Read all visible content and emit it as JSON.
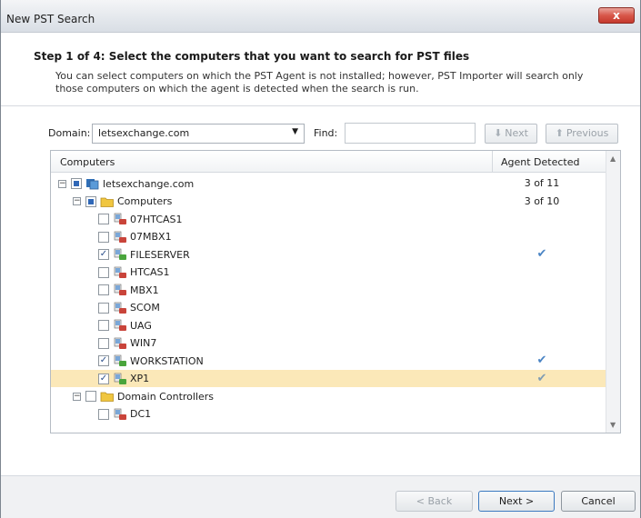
{
  "window": {
    "title": "New PST Search",
    "close_label": "x"
  },
  "header": {
    "step": "Step 1 of 4: Select the computers that you want to search for PST files",
    "description": "You can select computers on which the PST Agent is not installed; however, PST Importer will search only those computers on which the agent is detected when the search is run."
  },
  "toolbar": {
    "domain_label": "Domain:",
    "domain_value": "letsexchange.com",
    "find_label": "Find:",
    "find_value": "",
    "find_next_label": "Next",
    "find_previous_label": "Previous"
  },
  "grid": {
    "columns": [
      "Computers",
      "Agent Detected"
    ],
    "rows": [
      {
        "label": "letsexchange.com",
        "level": 0,
        "type": "domain",
        "checkbox": "partial",
        "expander": "−",
        "agent": "3 of 11",
        "agent_check": false,
        "selected": false
      },
      {
        "label": "Computers",
        "level": 1,
        "type": "folder",
        "checkbox": "partial",
        "expander": "−",
        "agent": "3 of 10",
        "agent_check": false,
        "selected": false
      },
      {
        "label": "07HTCAS1",
        "level": 2,
        "type": "computer-red",
        "checkbox": "unchecked",
        "agent": "",
        "agent_check": false,
        "selected": false
      },
      {
        "label": "07MBX1",
        "level": 2,
        "type": "computer-red",
        "checkbox": "unchecked",
        "agent": "",
        "agent_check": false,
        "selected": false
      },
      {
        "label": "FILESERVER",
        "level": 2,
        "type": "computer-green",
        "checkbox": "checked",
        "agent": "",
        "agent_check": true,
        "selected": false
      },
      {
        "label": "HTCAS1",
        "level": 2,
        "type": "computer-red",
        "checkbox": "unchecked",
        "agent": "",
        "agent_check": false,
        "selected": false
      },
      {
        "label": "MBX1",
        "level": 2,
        "type": "computer-red",
        "checkbox": "unchecked",
        "agent": "",
        "agent_check": false,
        "selected": false
      },
      {
        "label": "SCOM",
        "level": 2,
        "type": "computer-red",
        "checkbox": "unchecked",
        "agent": "",
        "agent_check": false,
        "selected": false
      },
      {
        "label": "UAG",
        "level": 2,
        "type": "computer-red",
        "checkbox": "unchecked",
        "agent": "",
        "agent_check": false,
        "selected": false
      },
      {
        "label": "WIN7",
        "level": 2,
        "type": "computer-red",
        "checkbox": "unchecked",
        "agent": "",
        "agent_check": false,
        "selected": false
      },
      {
        "label": "WORKSTATION",
        "level": 2,
        "type": "computer-green",
        "checkbox": "checked",
        "agent": "",
        "agent_check": true,
        "selected": false
      },
      {
        "label": "XP1",
        "level": 2,
        "type": "computer-green",
        "checkbox": "checked",
        "agent": "",
        "agent_check": true,
        "selected": true
      },
      {
        "label": "Domain Controllers",
        "level": 1,
        "type": "folder",
        "checkbox": "unchecked",
        "expander": "−",
        "agent": "",
        "agent_check": false,
        "selected": false
      },
      {
        "label": "DC1",
        "level": 2,
        "type": "computer-red",
        "checkbox": "unchecked",
        "agent": "",
        "agent_check": false,
        "selected": false
      }
    ]
  },
  "footer": {
    "back_label": "< Back",
    "next_label": "Next >",
    "cancel_label": "Cancel"
  },
  "colors": {
    "selected_row": "#fbe8b8",
    "check_blue": "#4a84c4",
    "computer_red": "#c9443a",
    "computer_green": "#4aa53c",
    "folder_yellow": "#f0c640"
  }
}
